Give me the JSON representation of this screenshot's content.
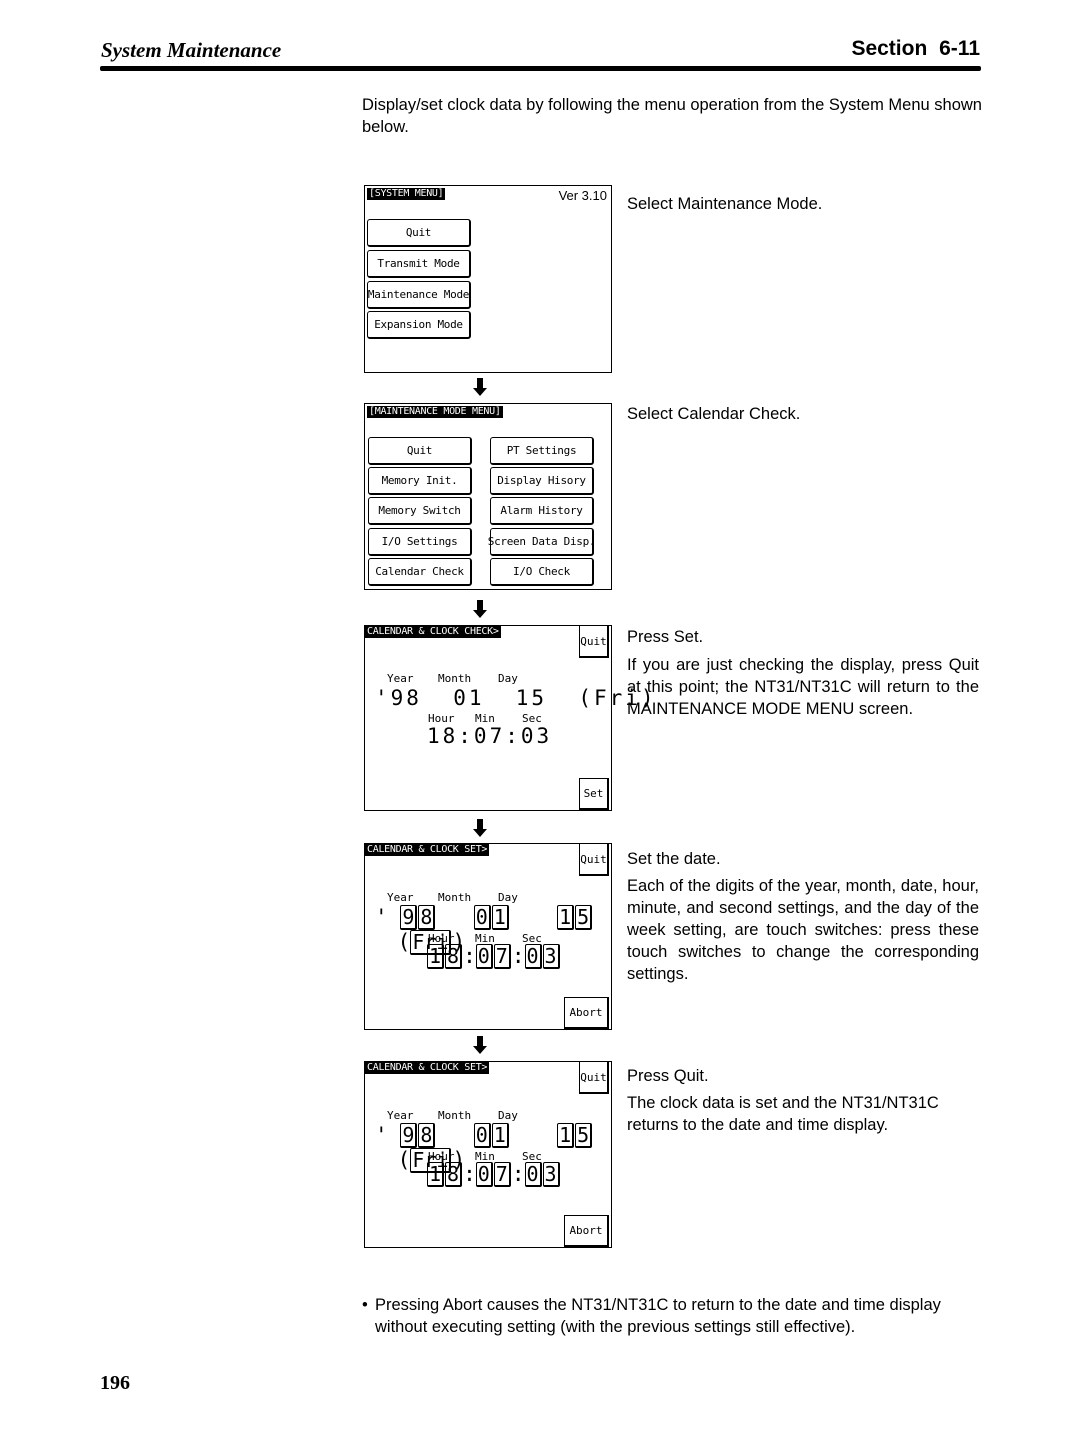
{
  "header": {
    "chapter": "System Maintenance",
    "section": "Section  6-11"
  },
  "intro": "Display/set clock data by following the menu operation from the System Menu shown below.",
  "screens": {
    "system_menu": {
      "title": "[SYSTEM MENU]",
      "version": "Ver 3.10",
      "buttons": [
        "Quit",
        "Transmit Mode",
        "Maintenance Mode",
        "Expansion Mode"
      ]
    },
    "maintenance_menu": {
      "title": "[MAINTENANCE MODE MENU]",
      "left_buttons": [
        "Quit",
        "Memory Init.",
        "Memory Switch",
        "I/O Settings",
        "Calendar Check"
      ],
      "right_buttons": [
        "PT Settings",
        "Display Hisory",
        "Alarm History",
        "Screen Data Disp.",
        "I/O Check"
      ]
    },
    "clock_check": {
      "title": "CALENDAR & CLOCK CHECK>",
      "quit": "Quit",
      "set": "Set",
      "labels": {
        "year": "Year",
        "month": "Month",
        "day": "Day",
        "hour": "Hour",
        "min": "Min",
        "sec": "Sec"
      },
      "date_line": "'98  01  15  (Fri)",
      "time_line": "18:07:03"
    },
    "clock_set": {
      "title": "CALENDAR & CLOCK SET>",
      "quit": "Quit",
      "abort": "Abort",
      "labels": {
        "year": "Year",
        "month": "Month",
        "day": "Day",
        "hour": "Hour",
        "min": "Min",
        "sec": "Sec"
      },
      "apostrophe": "'",
      "year": [
        "9",
        "8"
      ],
      "month": [
        "0",
        "1"
      ],
      "day": [
        "1",
        "5"
      ],
      "weekday": "Fri",
      "paren_open": "(",
      "paren_close": ")",
      "hour": [
        "1",
        "8"
      ],
      "minute": [
        "0",
        "7"
      ],
      "second": [
        "0",
        "3"
      ],
      "colon": ":"
    }
  },
  "steps": [
    {
      "title": "Select Maintenance Mode.",
      "desc": ""
    },
    {
      "title": "Select Calendar Check.",
      "desc": ""
    },
    {
      "title": "Press Set.",
      "desc": "If you are just checking the display, press Quit at this point; the NT31/NT31C will return to the MAINTENANCE MODE MENU screen."
    },
    {
      "title": "Set the date.",
      "desc": "Each of the digits of the year, month, date, hour, minute, and second settings, and the day of the week setting, are touch switches: press these touch switches to change the corresponding settings."
    },
    {
      "title": "Press Quit.",
      "desc": "The clock data is set and the NT31/NT31C returns to the date and time display."
    }
  ],
  "note": {
    "bullet": "•",
    "text": "Pressing Abort causes the NT31/NT31C to return to the date and time display without executing setting (with the previous settings still effective)."
  },
  "page_number": "196"
}
